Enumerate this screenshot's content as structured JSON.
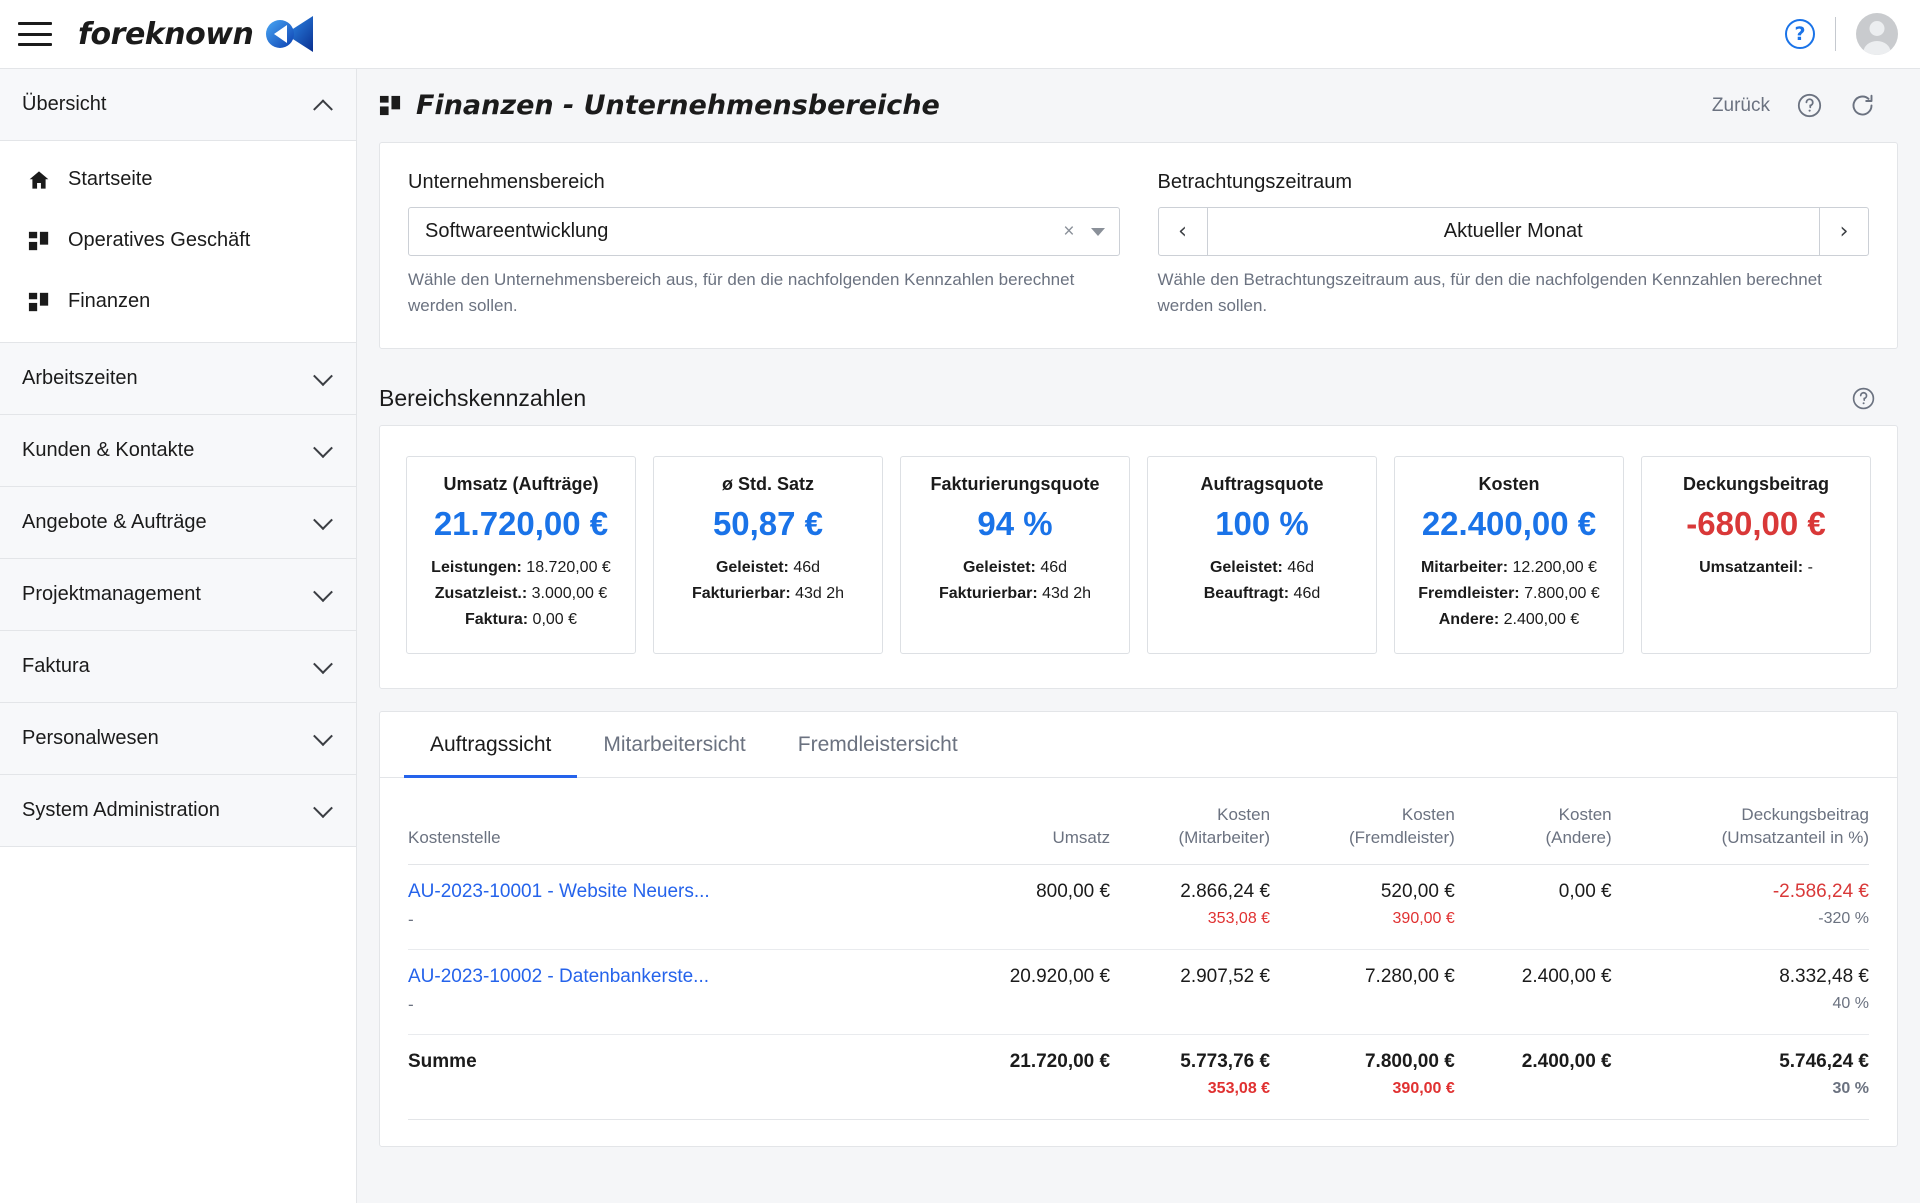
{
  "topbar": {
    "brand_name": "foreknown",
    "menu_icon": "hamburger-menu-icon",
    "help_glyph": "?",
    "avatar_icon": "user-avatar-icon"
  },
  "sidebar": {
    "groups": [
      {
        "label": "Übersicht",
        "expanded": true,
        "chevron": "chevron-up-icon",
        "items": [
          {
            "label": "Startseite",
            "icon": "home-icon"
          },
          {
            "label": "Operatives Geschäft",
            "icon": "grid-icon"
          },
          {
            "label": "Finanzen",
            "icon": "grid-icon"
          }
        ]
      },
      {
        "label": "Arbeitszeiten",
        "expanded": false,
        "chevron": "chevron-down-icon",
        "items": []
      },
      {
        "label": "Kunden & Kontakte",
        "expanded": false,
        "chevron": "chevron-down-icon",
        "items": []
      },
      {
        "label": "Angebote & Aufträge",
        "expanded": false,
        "chevron": "chevron-down-icon",
        "items": []
      },
      {
        "label": "Projektmanagement",
        "expanded": false,
        "chevron": "chevron-down-icon",
        "items": []
      },
      {
        "label": "Faktura",
        "expanded": false,
        "chevron": "chevron-down-icon",
        "items": []
      },
      {
        "label": "Personalwesen",
        "expanded": false,
        "chevron": "chevron-down-icon",
        "items": []
      },
      {
        "label": "System Administration",
        "expanded": false,
        "chevron": "chevron-down-icon",
        "items": []
      }
    ]
  },
  "page": {
    "title": "Finanzen - Unternehmensbereiche",
    "title_icon": "grid-icon",
    "back_label": "Zurück",
    "help_icon": "help-circle-icon",
    "refresh_icon": "refresh-icon"
  },
  "filters": {
    "business_unit": {
      "label": "Unternehmensbereich",
      "value": "Softwareentwicklung",
      "clear_glyph": "×",
      "dropdown_icon": "chevron-down-icon",
      "hint": "Wähle den Unternehmensbereich aus, für den die nachfolgenden Kennzahlen berechnet werden sollen."
    },
    "period": {
      "label": "Betrachtungszeitraum",
      "value": "Aktueller Monat",
      "prev_glyph": "‹",
      "next_glyph": "›",
      "hint": "Wähle den Betrachtungszeitraum aus, für den die nachfolgenden Kennzahlen berechnet werden sollen."
    }
  },
  "kpi_section": {
    "title": "Bereichskennzahlen",
    "help_icon": "help-circle-icon",
    "cards": [
      {
        "title": "Umsatz (Aufträge)",
        "value": "21.720,00 €",
        "negative": false,
        "subs": [
          {
            "label": "Leistungen:",
            "value": "18.720,00 €"
          },
          {
            "label": "Zusatzleist.:",
            "value": "3.000,00 €"
          },
          {
            "label": "Faktura:",
            "value": "0,00 €"
          }
        ]
      },
      {
        "title": "ø Std. Satz",
        "value": "50,87 €",
        "negative": false,
        "subs": [
          {
            "label": "Geleistet:",
            "value": "46d"
          },
          {
            "label": "Fakturierbar:",
            "value": "43d 2h"
          }
        ]
      },
      {
        "title": "Fakturierungsquote",
        "value": "94 %",
        "negative": false,
        "subs": [
          {
            "label": "Geleistet:",
            "value": "46d"
          },
          {
            "label": "Fakturierbar:",
            "value": "43d 2h"
          }
        ]
      },
      {
        "title": "Auftragsquote",
        "value": "100 %",
        "negative": false,
        "subs": [
          {
            "label": "Geleistet:",
            "value": "46d"
          },
          {
            "label": "Beauftragt:",
            "value": "46d"
          }
        ]
      },
      {
        "title": "Kosten",
        "value": "22.400,00 €",
        "negative": false,
        "subs": [
          {
            "label": "Mitarbeiter:",
            "value": "12.200,00 €"
          },
          {
            "label": "Fremdleister:",
            "value": "7.800,00 €"
          },
          {
            "label": "Andere:",
            "value": "2.400,00 €"
          }
        ]
      },
      {
        "title": "Deckungsbeitrag",
        "value": "-680,00 €",
        "negative": true,
        "subs": [
          {
            "label": "Umsatzanteil:",
            "value": "-"
          }
        ]
      }
    ]
  },
  "tabs": [
    {
      "label": "Auftragssicht",
      "active": true
    },
    {
      "label": "Mitarbeitersicht",
      "active": false
    },
    {
      "label": "Fremdleistersicht",
      "active": false
    }
  ],
  "table": {
    "headers": [
      {
        "line1": "",
        "line2": "Kostenstelle",
        "align": "left"
      },
      {
        "line1": "",
        "line2": "Umsatz",
        "align": "right"
      },
      {
        "line1": "Kosten",
        "line2": "(Mitarbeiter)",
        "align": "right"
      },
      {
        "line1": "Kosten",
        "line2": "(Fremdleister)",
        "align": "right"
      },
      {
        "line1": "Kosten",
        "line2": "(Andere)",
        "align": "right"
      },
      {
        "line1": "Deckungsbeitrag",
        "line2": "(Umsatzanteil in %)",
        "align": "right"
      }
    ],
    "rows": [
      {
        "type": "data",
        "cost_center": "AU-2023-10001 - Website Neuers...",
        "cost_center_sub": "-",
        "revenue": "800,00 €",
        "revenue_sub": "",
        "cost_employee": "2.866,24 €",
        "cost_employee_sub": "353,08 €",
        "cost_external": "520,00 €",
        "cost_external_sub": "390,00 €",
        "cost_other": "0,00 €",
        "cost_other_sub": "",
        "margin": "-2.586,24 €",
        "margin_negative": true,
        "margin_sub": "-320 %"
      },
      {
        "type": "data",
        "cost_center": "AU-2023-10002 - Datenbankerste...",
        "cost_center_sub": "-",
        "revenue": "20.920,00 €",
        "revenue_sub": "",
        "cost_employee": "2.907,52 €",
        "cost_employee_sub": "",
        "cost_external": "7.280,00 €",
        "cost_external_sub": "",
        "cost_other": "2.400,00 €",
        "cost_other_sub": "",
        "margin": "8.332,48 €",
        "margin_negative": false,
        "margin_sub": "40 %"
      },
      {
        "type": "total",
        "cost_center": "Summe",
        "cost_center_sub": "",
        "revenue": "21.720,00 €",
        "revenue_sub": "",
        "cost_employee": "5.773,76 €",
        "cost_employee_sub": "353,08 €",
        "cost_external": "7.800,00 €",
        "cost_external_sub": "390,00 €",
        "cost_other": "2.400,00 €",
        "cost_other_sub": "",
        "margin": "5.746,24 €",
        "margin_negative": false,
        "margin_sub": "30 %"
      }
    ]
  },
  "colors": {
    "accent_blue": "#1a73e8",
    "link_blue": "#2563eb",
    "negative_red": "#d93838",
    "sub_red": "#e03131",
    "muted": "#6b7280"
  }
}
